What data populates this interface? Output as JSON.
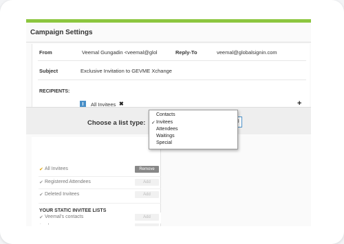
{
  "panel": {
    "title": "Campaign Settings"
  },
  "form": {
    "from_label": "From",
    "from_value": "Veemal Gungadin <veemal@glol",
    "reply_to_label": "Reply-To",
    "reply_to_value": "veemal@globalsignin.com",
    "subject_label": "Subject",
    "subject_value": "Exclusive Invitation to GEVME Xchange"
  },
  "recipients": {
    "label": "RECIPIENTS:",
    "chip_badge": "I",
    "chip_label": "All Invitees",
    "chip_remove": "✖",
    "add_symbol": "+"
  },
  "chooser": {
    "label": "Choose a list type:",
    "selected": "Invitees",
    "check": "✓",
    "options": [
      "Contacts",
      "Invitees",
      "Attendees",
      "Waitings",
      "Special"
    ]
  },
  "lists": {
    "tick": "✔",
    "remove_label": "Remove",
    "add_label": "Add",
    "rows": [
      "All Invitees",
      "Registered Attendees",
      "Deleted Invitees"
    ],
    "section_title": "YOUR STATIC INVITEE LISTS",
    "static_rows": [
      "Special Guests",
      "Veemal's contacts"
    ]
  },
  "colors": {
    "accent_green": "#8cc63f",
    "accent_blue": "#4a90c8",
    "tick_active": "#e0a100"
  }
}
